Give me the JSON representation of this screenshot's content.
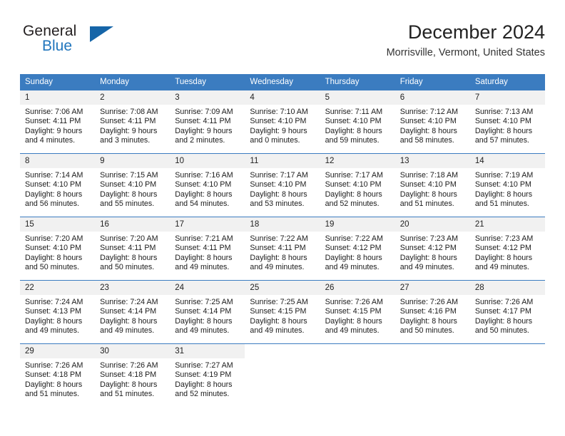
{
  "brand": {
    "name_top": "General",
    "name_bottom": "Blue",
    "accent_color": "#2176bd",
    "triangle_color": "#1565a8"
  },
  "header": {
    "month_title": "December 2024",
    "location": "Morrisville, Vermont, United States",
    "header_bg_color": "#3b7cc0"
  },
  "weekday_headers": [
    "Sunday",
    "Monday",
    "Tuesday",
    "Wednesday",
    "Thursday",
    "Friday",
    "Saturday"
  ],
  "weeks": [
    [
      {
        "day": "1",
        "sunrise": "Sunrise: 7:06 AM",
        "sunset": "Sunset: 4:11 PM",
        "daylight_line1": "Daylight: 9 hours",
        "daylight_line2": "and 4 minutes."
      },
      {
        "day": "2",
        "sunrise": "Sunrise: 7:08 AM",
        "sunset": "Sunset: 4:11 PM",
        "daylight_line1": "Daylight: 9 hours",
        "daylight_line2": "and 3 minutes."
      },
      {
        "day": "3",
        "sunrise": "Sunrise: 7:09 AM",
        "sunset": "Sunset: 4:11 PM",
        "daylight_line1": "Daylight: 9 hours",
        "daylight_line2": "and 2 minutes."
      },
      {
        "day": "4",
        "sunrise": "Sunrise: 7:10 AM",
        "sunset": "Sunset: 4:10 PM",
        "daylight_line1": "Daylight: 9 hours",
        "daylight_line2": "and 0 minutes."
      },
      {
        "day": "5",
        "sunrise": "Sunrise: 7:11 AM",
        "sunset": "Sunset: 4:10 PM",
        "daylight_line1": "Daylight: 8 hours",
        "daylight_line2": "and 59 minutes."
      },
      {
        "day": "6",
        "sunrise": "Sunrise: 7:12 AM",
        "sunset": "Sunset: 4:10 PM",
        "daylight_line1": "Daylight: 8 hours",
        "daylight_line2": "and 58 minutes."
      },
      {
        "day": "7",
        "sunrise": "Sunrise: 7:13 AM",
        "sunset": "Sunset: 4:10 PM",
        "daylight_line1": "Daylight: 8 hours",
        "daylight_line2": "and 57 minutes."
      }
    ],
    [
      {
        "day": "8",
        "sunrise": "Sunrise: 7:14 AM",
        "sunset": "Sunset: 4:10 PM",
        "daylight_line1": "Daylight: 8 hours",
        "daylight_line2": "and 56 minutes."
      },
      {
        "day": "9",
        "sunrise": "Sunrise: 7:15 AM",
        "sunset": "Sunset: 4:10 PM",
        "daylight_line1": "Daylight: 8 hours",
        "daylight_line2": "and 55 minutes."
      },
      {
        "day": "10",
        "sunrise": "Sunrise: 7:16 AM",
        "sunset": "Sunset: 4:10 PM",
        "daylight_line1": "Daylight: 8 hours",
        "daylight_line2": "and 54 minutes."
      },
      {
        "day": "11",
        "sunrise": "Sunrise: 7:17 AM",
        "sunset": "Sunset: 4:10 PM",
        "daylight_line1": "Daylight: 8 hours",
        "daylight_line2": "and 53 minutes."
      },
      {
        "day": "12",
        "sunrise": "Sunrise: 7:17 AM",
        "sunset": "Sunset: 4:10 PM",
        "daylight_line1": "Daylight: 8 hours",
        "daylight_line2": "and 52 minutes."
      },
      {
        "day": "13",
        "sunrise": "Sunrise: 7:18 AM",
        "sunset": "Sunset: 4:10 PM",
        "daylight_line1": "Daylight: 8 hours",
        "daylight_line2": "and 51 minutes."
      },
      {
        "day": "14",
        "sunrise": "Sunrise: 7:19 AM",
        "sunset": "Sunset: 4:10 PM",
        "daylight_line1": "Daylight: 8 hours",
        "daylight_line2": "and 51 minutes."
      }
    ],
    [
      {
        "day": "15",
        "sunrise": "Sunrise: 7:20 AM",
        "sunset": "Sunset: 4:10 PM",
        "daylight_line1": "Daylight: 8 hours",
        "daylight_line2": "and 50 minutes."
      },
      {
        "day": "16",
        "sunrise": "Sunrise: 7:20 AM",
        "sunset": "Sunset: 4:11 PM",
        "daylight_line1": "Daylight: 8 hours",
        "daylight_line2": "and 50 minutes."
      },
      {
        "day": "17",
        "sunrise": "Sunrise: 7:21 AM",
        "sunset": "Sunset: 4:11 PM",
        "daylight_line1": "Daylight: 8 hours",
        "daylight_line2": "and 49 minutes."
      },
      {
        "day": "18",
        "sunrise": "Sunrise: 7:22 AM",
        "sunset": "Sunset: 4:11 PM",
        "daylight_line1": "Daylight: 8 hours",
        "daylight_line2": "and 49 minutes."
      },
      {
        "day": "19",
        "sunrise": "Sunrise: 7:22 AM",
        "sunset": "Sunset: 4:12 PM",
        "daylight_line1": "Daylight: 8 hours",
        "daylight_line2": "and 49 minutes."
      },
      {
        "day": "20",
        "sunrise": "Sunrise: 7:23 AM",
        "sunset": "Sunset: 4:12 PM",
        "daylight_line1": "Daylight: 8 hours",
        "daylight_line2": "and 49 minutes."
      },
      {
        "day": "21",
        "sunrise": "Sunrise: 7:23 AM",
        "sunset": "Sunset: 4:12 PM",
        "daylight_line1": "Daylight: 8 hours",
        "daylight_line2": "and 49 minutes."
      }
    ],
    [
      {
        "day": "22",
        "sunrise": "Sunrise: 7:24 AM",
        "sunset": "Sunset: 4:13 PM",
        "daylight_line1": "Daylight: 8 hours",
        "daylight_line2": "and 49 minutes."
      },
      {
        "day": "23",
        "sunrise": "Sunrise: 7:24 AM",
        "sunset": "Sunset: 4:14 PM",
        "daylight_line1": "Daylight: 8 hours",
        "daylight_line2": "and 49 minutes."
      },
      {
        "day": "24",
        "sunrise": "Sunrise: 7:25 AM",
        "sunset": "Sunset: 4:14 PM",
        "daylight_line1": "Daylight: 8 hours",
        "daylight_line2": "and 49 minutes."
      },
      {
        "day": "25",
        "sunrise": "Sunrise: 7:25 AM",
        "sunset": "Sunset: 4:15 PM",
        "daylight_line1": "Daylight: 8 hours",
        "daylight_line2": "and 49 minutes."
      },
      {
        "day": "26",
        "sunrise": "Sunrise: 7:26 AM",
        "sunset": "Sunset: 4:15 PM",
        "daylight_line1": "Daylight: 8 hours",
        "daylight_line2": "and 49 minutes."
      },
      {
        "day": "27",
        "sunrise": "Sunrise: 7:26 AM",
        "sunset": "Sunset: 4:16 PM",
        "daylight_line1": "Daylight: 8 hours",
        "daylight_line2": "and 50 minutes."
      },
      {
        "day": "28",
        "sunrise": "Sunrise: 7:26 AM",
        "sunset": "Sunset: 4:17 PM",
        "daylight_line1": "Daylight: 8 hours",
        "daylight_line2": "and 50 minutes."
      }
    ],
    [
      {
        "day": "29",
        "sunrise": "Sunrise: 7:26 AM",
        "sunset": "Sunset: 4:18 PM",
        "daylight_line1": "Daylight: 8 hours",
        "daylight_line2": "and 51 minutes."
      },
      {
        "day": "30",
        "sunrise": "Sunrise: 7:26 AM",
        "sunset": "Sunset: 4:18 PM",
        "daylight_line1": "Daylight: 8 hours",
        "daylight_line2": "and 51 minutes."
      },
      {
        "day": "31",
        "sunrise": "Sunrise: 7:27 AM",
        "sunset": "Sunset: 4:19 PM",
        "daylight_line1": "Daylight: 8 hours",
        "daylight_line2": "and 52 minutes."
      },
      {
        "day": "",
        "sunrise": "",
        "sunset": "",
        "daylight_line1": "",
        "daylight_line2": ""
      },
      {
        "day": "",
        "sunrise": "",
        "sunset": "",
        "daylight_line1": "",
        "daylight_line2": ""
      },
      {
        "day": "",
        "sunrise": "",
        "sunset": "",
        "daylight_line1": "",
        "daylight_line2": ""
      },
      {
        "day": "",
        "sunrise": "",
        "sunset": "",
        "daylight_line1": "",
        "daylight_line2": ""
      }
    ]
  ]
}
